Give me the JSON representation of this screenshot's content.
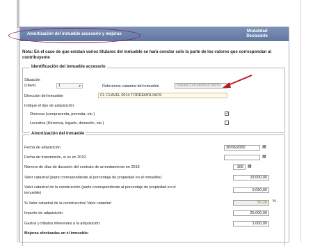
{
  "header": {
    "title": "Amortización del inmueble accesorio y mejoras",
    "modalidad": "Modalidad",
    "modalidad_value": "Declarante"
  },
  "note": "Nota: En el caso de que existan varios titulares del inmueble se hará constar sólo la parte de los valores que correspondan al contribuyente",
  "identificacion": {
    "title": "Identificación del inmueble accesorio",
    "situacion_label": "Situación",
    "situacion_sub": "(clave)",
    "situacion_value": "1",
    "referencia_label": "Referencia catastral del inmueble",
    "referencia_value": "5684601VK4858S0158TF",
    "direccion_label": "Dirección del inmueble",
    "direccion_value": "CL CLAVEL 0014   TORREMOLINOS",
    "tipo_label": "Indique el tipo de adquisición:",
    "onerosa_label": "Onerosa (compraventa, permuta, etc.)",
    "onerosa_checked": "✓",
    "lucrativa_label": "Lucrativa (Herencia, legado, donación, etc.)"
  },
  "amortizacion": {
    "title": "Amortización del inmueble",
    "fecha_adq_label": "Fecha de adquisición",
    "fecha_adq_value": "30/06/2000",
    "fecha_trans_label": "Fecha de transmisión, si es en 2019",
    "fecha_trans_value": "",
    "dias_label": "Número de días de duración del contrato de arrendamiento en 2019",
    "dias_value": "306",
    "valor_cat_label": "Valor catastral (parte correspondiente al porcentaje de propiedad en el inmueble)",
    "valor_cat_value": "18.000,00",
    "valor_cons_label_1": "Valor catastral de la construcción (parte correspondiente al porcentaje de propiedad en el",
    "valor_cons_label_2": "inmueble)",
    "valor_cons_value": "9.050,00",
    "porcentaje_label": "% Valor catastral de la construcción/ Valor catastral",
    "porcentaje_value": "50,28",
    "porcentaje_unit": "%",
    "importe_label": "Importe de adquisición",
    "importe_value": "25.000,00",
    "gastos_label": "Gastos y tributos inherentes a la adquisición:",
    "gastos_value": "1.000,00",
    "mejoras_label": "Mejoras efectuadas en el inmueble:"
  },
  "colors": {
    "header": "#6a80a8",
    "annotation": "#8a1a5a",
    "arrow": "#c0171f"
  }
}
